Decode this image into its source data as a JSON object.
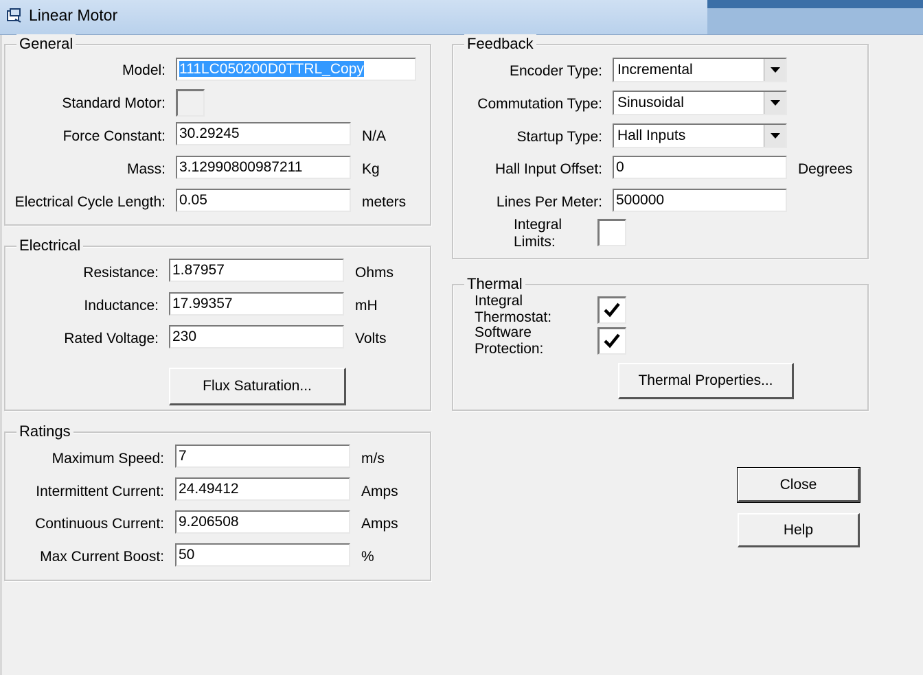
{
  "window": {
    "title": "Linear Motor",
    "icon": "motor-app-icon"
  },
  "general": {
    "legend": "General",
    "model_label": "Model:",
    "model_value": "111LC050200D0TTRL_Copy",
    "standard_motor_label": "Standard Motor:",
    "standard_motor_checked": false,
    "force_constant_label": "Force Constant:",
    "force_constant_value": "30.29245",
    "force_constant_unit": "N/A",
    "mass_label": "Mass:",
    "mass_value": "3.12990800987211",
    "mass_unit": "Kg",
    "cycle_length_label": "Electrical Cycle Length:",
    "cycle_length_value": "0.05",
    "cycle_length_unit": "meters"
  },
  "electrical": {
    "legend": "Electrical",
    "resistance_label": "Resistance:",
    "resistance_value": "1.87957",
    "resistance_unit": "Ohms",
    "inductance_label": "Inductance:",
    "inductance_value": "17.99357",
    "inductance_unit": "mH",
    "rated_voltage_label": "Rated Voltage:",
    "rated_voltage_value": "230",
    "rated_voltage_unit": "Volts",
    "flux_button": "Flux Saturation..."
  },
  "ratings": {
    "legend": "Ratings",
    "max_speed_label": "Maximum Speed:",
    "max_speed_value": "7",
    "max_speed_unit": "m/s",
    "intermittent_label": "Intermittent Current:",
    "intermittent_value": "24.49412",
    "intermittent_unit": "Amps",
    "continuous_label": "Continuous Current:",
    "continuous_value": "9.206508",
    "continuous_unit": "Amps",
    "boost_label": "Max Current Boost:",
    "boost_value": "50",
    "boost_unit": "%"
  },
  "feedback": {
    "legend": "Feedback",
    "encoder_label": "Encoder Type:",
    "encoder_value": "Incremental",
    "commutation_label": "Commutation Type:",
    "commutation_value": "Sinusoidal",
    "startup_label": "Startup Type:",
    "startup_value": "Hall Inputs",
    "hall_offset_label": "Hall Input Offset:",
    "hall_offset_value": "0",
    "hall_offset_unit": "Degrees",
    "lines_label": "Lines Per Meter:",
    "lines_value": "500000",
    "integral_limits_line1": "Integral",
    "integral_limits_line2": "Limits:",
    "integral_limits_checked": false
  },
  "thermal": {
    "legend": "Thermal",
    "thermostat_line1": "Integral",
    "thermostat_line2": "Thermostat:",
    "thermostat_checked": true,
    "software_line1": "Software",
    "software_line2": "Protection:",
    "software_checked": true,
    "properties_button": "Thermal Properties..."
  },
  "actions": {
    "close": "Close",
    "help": "Help"
  }
}
